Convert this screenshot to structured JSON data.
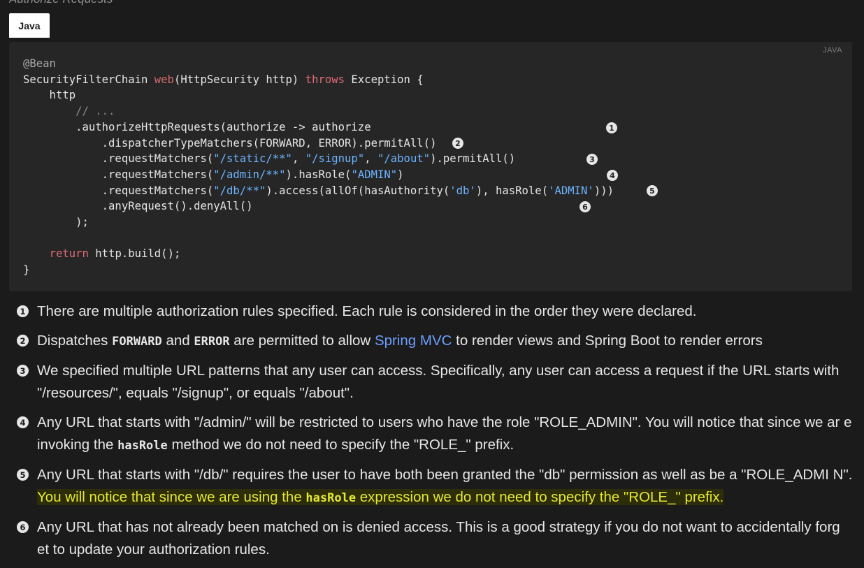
{
  "section_title": "Authorize Requests",
  "tab_label": "Java",
  "code": {
    "lang_label": "JAVA",
    "lines": {
      "l1": {
        "a": "@Bean"
      },
      "l2": {
        "a": "SecurityFilterChain ",
        "b": "web",
        "c": "(HttpSecurity http) ",
        "d": "throws",
        "e": " Exception {"
      },
      "l3": {
        "a": "    http"
      },
      "l4": {
        "a": "        // ..."
      },
      "l5": {
        "a": "        .authorizeHttpRequests(authorize -> authorize"
      },
      "l6": {
        "a": "            .dispatcherTypeMatchers(FORWARD, ERROR).permitAll()"
      },
      "l7": {
        "a": "            .requestMatchers(",
        "b": "\"/static/**\"",
        "c": ", ",
        "d": "\"/signup\"",
        "e": ", ",
        "f": "\"/about\"",
        "g": ").permitAll()"
      },
      "l8": {
        "a": "            .requestMatchers(",
        "b": "\"/admin/**\"",
        "c": ").hasRole(",
        "d": "\"ADMIN\"",
        "e": ")"
      },
      "l9": {
        "a": "            .requestMatchers(",
        "b": "\"/db/**\"",
        "c": ").access(allOf(hasAuthority(",
        "d": "'db'",
        "e": "), hasRole(",
        "f": "'ADMIN'",
        "g": ")))"
      },
      "l10": {
        "a": "            .anyRequest().denyAll()"
      },
      "l11": {
        "a": "        );"
      },
      "l12": {
        "a": ""
      },
      "l13": {
        "a": "    ",
        "b": "return",
        "c": " http.build();"
      },
      "l14": {
        "a": "}"
      }
    },
    "markers": [
      "1",
      "2",
      "3",
      "4",
      "5",
      "6"
    ]
  },
  "callouts": [
    {
      "num": "1",
      "text": "There are multiple authorization rules specified. Each rule is considered in the order they were declared."
    },
    {
      "num": "2",
      "t1": "Dispatches ",
      "c1": "FORWARD",
      "t2": " and ",
      "c2": "ERROR",
      "t3": " are permitted to allow ",
      "link": "Spring MVC",
      "t4": " to render views and Spring Boot to render errors"
    },
    {
      "num": "3",
      "text": "We specified multiple URL patterns that any user can access. Specifically, any user can access a request if the URL starts with \"/resources/\", equals \"/signup\", or equals \"/about\"."
    },
    {
      "num": "4",
      "t1": "Any URL that starts with \"/admin/\" will be restricted to users who have the role \"ROLE_ADMIN\". You will notice that since we ar e invoking the ",
      "c1": "hasRole",
      "t2": " method we do not need to specify the \"ROLE_\" prefix."
    },
    {
      "num": "5",
      "t1": "Any URL that starts with \"/db/\" requires the user to have both been granted the \"db\" permission as well as be a \"ROLE_ADMI N\". ",
      "h1": "You will notice that since we are using the ",
      "c1": "hasRole",
      "h2": " expression we do not need to specify the \"ROLE_\" prefix."
    },
    {
      "num": "6",
      "text": "Any URL that has not already been matched on is denied access. This is a good strategy if you do not want to accidentally forg et to update your authorization rules."
    }
  ]
}
